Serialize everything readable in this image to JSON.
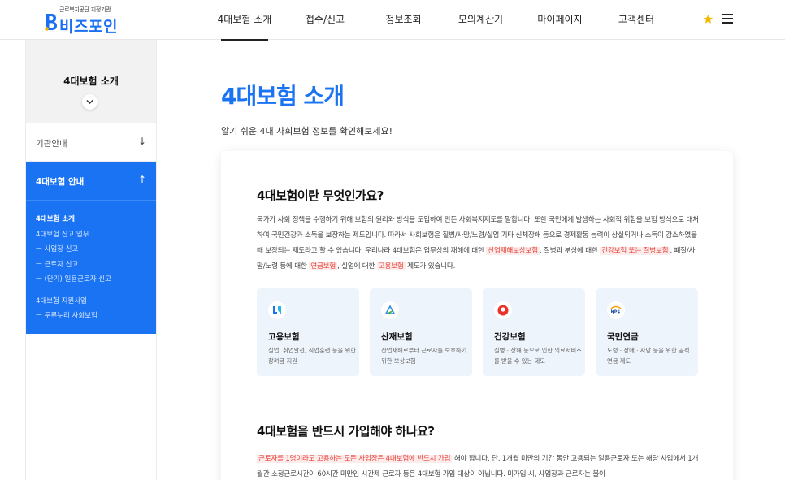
{
  "header": {
    "logo_sub": "근로복지공단 지정기관",
    "logo_main": "비즈포인",
    "nav": [
      {
        "label": "4대보험 소개"
      },
      {
        "label": "접수/신고"
      },
      {
        "label": "정보조회"
      },
      {
        "label": "모의계산기"
      },
      {
        "label": "마이페이지"
      },
      {
        "label": "고객센터"
      }
    ]
  },
  "sidebar": {
    "title": "4대보험 소개",
    "item_guide": "기관안내",
    "open_section": "4대보험 안내",
    "sub_items": [
      {
        "label": "4대보험 소개"
      },
      {
        "label": "4대보험 신고 업무"
      },
      {
        "label": "ㅡ 사업장 신고"
      },
      {
        "label": "ㅡ 근로자 신고"
      },
      {
        "label": "ㅡ (단기) 일용근로자 신고"
      },
      {
        "label": "4대보험 지원사업"
      },
      {
        "label": "ㅡ 두루누리 사회보험"
      }
    ]
  },
  "main": {
    "title": "4대보험 소개",
    "desc": "알기 쉬운 4대 사회보험 정보를 확인해보세요!",
    "section1": {
      "heading": "4대보험이란 무엇인가요?",
      "p1": "국가가 사회 정책을 수행하기 위해 보험의 원리와 방식을 도입하여 만든 사회복지제도를 말합니다. 또한 국민에게 발생하는 사회적 위험을 보험 방식으로 대처하여 국민건강과 소득을 보장하는 제도입니다. 따라서 사회보험은 질병/사망/노령/실업 기타 신체장애 등으로 경제활동 능력이 상실되거나 소득이 감소하였을 때 보장되는 제도라고 할 수 있습니다. 우리나라 4대보험은 업무상의 재해에 대한",
      "hl1": "산업재해보상보험",
      "p2": ", 질병과 부상에 대한",
      "hl2": "건강보험 또는 질병보험",
      "p3": ", 폐질/사망/노령 등에 대한",
      "hl3": "연금보험",
      "p4": ", 실업에 대한",
      "hl4": "고용보험",
      "p5": "제도가 있습니다."
    },
    "cards": [
      {
        "title": "고용보험",
        "desc": "실업, 취업알선, 직업훈련 등을 위한 장려금 지원",
        "icon": "employment-insurance-icon",
        "color": "#1a73f2"
      },
      {
        "title": "산재보험",
        "desc": "산업재해로부터 근로자를 보호하기 위한 보상보험",
        "icon": "industrial-accident-icon",
        "color": "#3a8de0"
      },
      {
        "title": "건강보험",
        "desc": "질병 · 상해 등으로 인한 의료서비스를 받을 수 있는 제도",
        "icon": "health-insurance-icon",
        "color": "#e8332b"
      },
      {
        "title": "국민연금",
        "desc": "노령 · 장애 · 사망 등을 위한 공적 연금 제도",
        "icon": "national-pension-icon",
        "color": "#1f4fa8"
      }
    ],
    "section2": {
      "heading": "4대보험을 반드시 가입해야 하나요?",
      "hl": "근로자를 1명이라도 고용하는 모든 사업장은 4대보험에 반드시 가입",
      "text": "해야 합니다. 단, 1개월 미만의 기간 동안 고용되는 일용근로자 또는 해당 사업에서 1개월간 소정근로시간이 60시간 미만인 시간제 근로자 등은 4대보험 가입 대상이 아닙니다. 미가입 시, 사업장과 근로자는 불이"
    }
  }
}
